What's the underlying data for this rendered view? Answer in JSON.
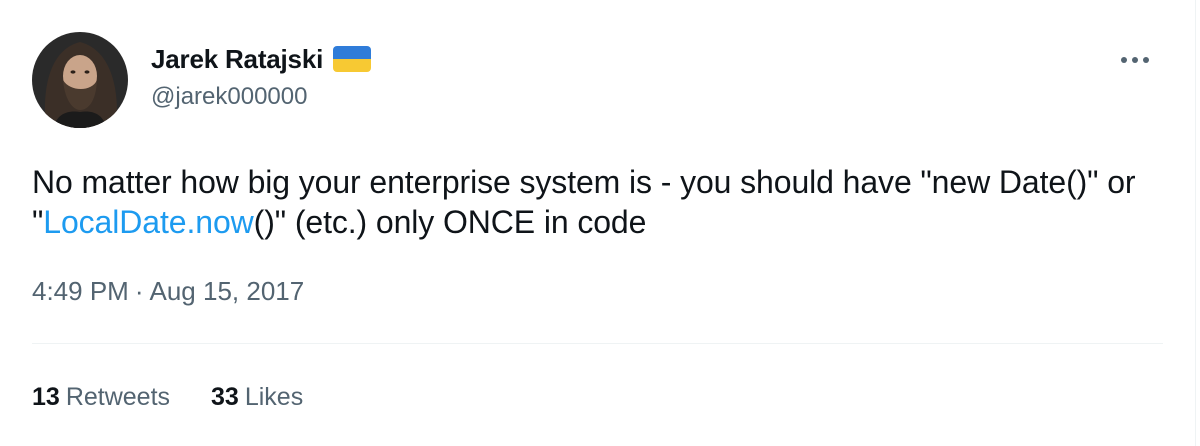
{
  "author": {
    "display_name": "Jarek Ratajski",
    "handle": "@jarek000000",
    "flag_icon": "ukraine-flag-icon",
    "avatar": "profile-photo"
  },
  "tweet": {
    "text_before": "No matter how big your enterprise system is - you should have \"new Date()\" or \"",
    "link_text": "LocalDate.now",
    "text_after": "()\" (etc.) only ONCE in code",
    "time": "4:49 PM",
    "separator": "·",
    "date": "Aug 15, 2017"
  },
  "stats": {
    "retweets_count": "13",
    "retweets_label": "Retweets",
    "likes_count": "33",
    "likes_label": "Likes"
  },
  "colors": {
    "link": "#1d9bf0",
    "secondary_text": "#536471",
    "primary_text": "#0f1419",
    "flag_blue": "#2f7cd9",
    "flag_yellow": "#f7c933"
  },
  "icons": {
    "more": "more-horizontal-icon"
  }
}
